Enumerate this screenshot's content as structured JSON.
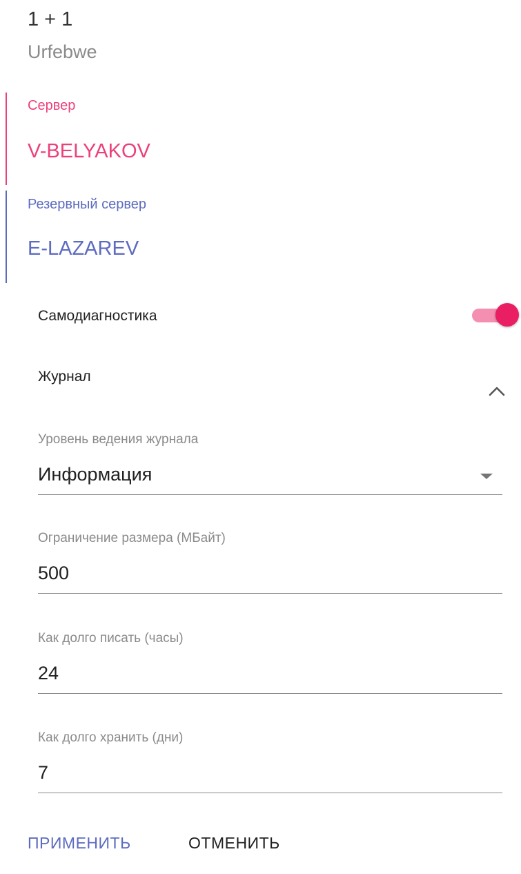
{
  "header": {
    "title": "1 + 1",
    "subtitle": "Urfebwe"
  },
  "server": {
    "label": "Сервер",
    "value": "V-BELYAKOV",
    "color": "#ec407a"
  },
  "backup_server": {
    "label": "Резервный сервер",
    "value": "E-LAZAREV",
    "color": "#5c6bc0"
  },
  "self_diagnostics": {
    "label": "Самодиагностика",
    "enabled": true,
    "accent": "#e91e63"
  },
  "journal": {
    "label": "Журнал",
    "expanded": true,
    "icon": "chevron-up-icon"
  },
  "fields": {
    "log_level": {
      "label": "Уровень ведения журнала",
      "value": "Информация",
      "icon": "dropdown-arrow-icon"
    },
    "size_limit": {
      "label": "Ограничение размера (МБайт)",
      "value": "500"
    },
    "write_duration": {
      "label": "Как долго писать (часы)",
      "value": "24"
    },
    "retention": {
      "label": "Как долго хранить (дни)",
      "value": "7"
    }
  },
  "actions": {
    "apply": "ПРИМЕНИТЬ",
    "cancel": "ОТМЕНИТЬ",
    "apply_color": "#5c6bc0"
  }
}
